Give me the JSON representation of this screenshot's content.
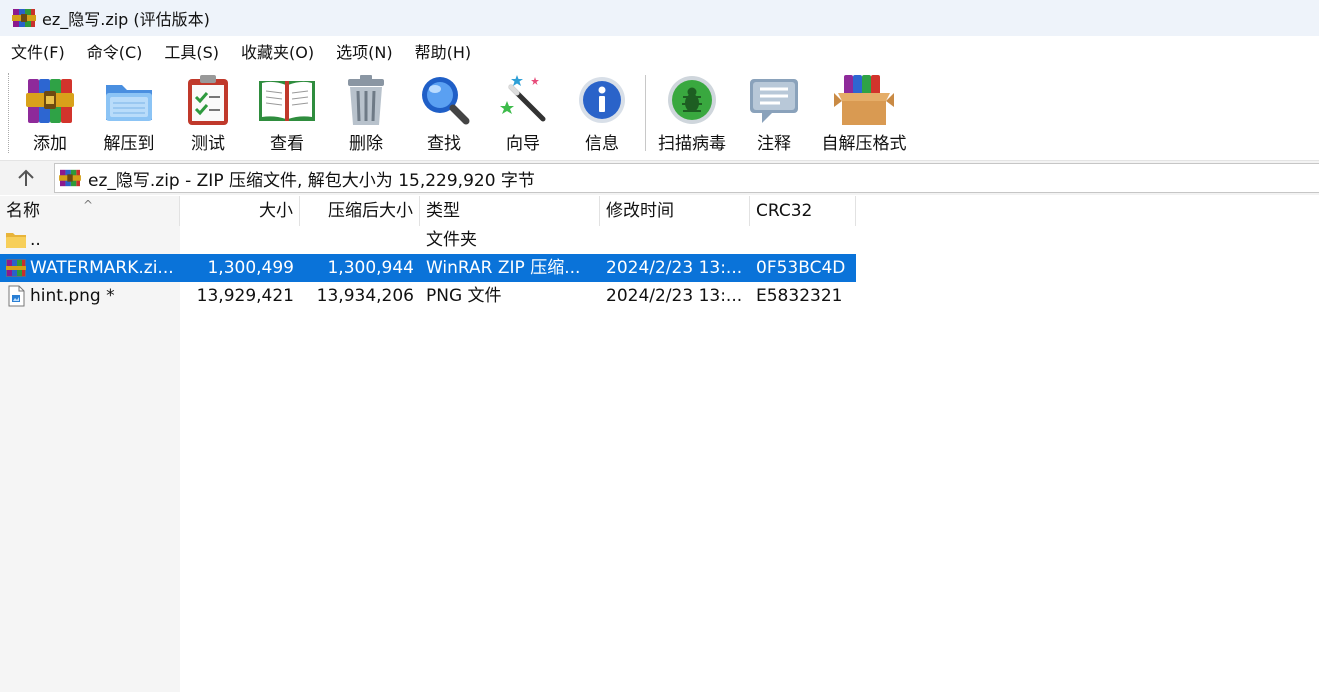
{
  "window": {
    "title": "ez_隐写.zip (评估版本)",
    "app_icon": "winrar-icon"
  },
  "menu": [
    "文件(F)",
    "命令(C)",
    "工具(S)",
    "收藏夹(O)",
    "选项(N)",
    "帮助(H)"
  ],
  "toolbar": {
    "add": "添加",
    "extract_to": "解压到",
    "test": "测试",
    "view": "查看",
    "delete": "删除",
    "find": "查找",
    "wizard": "向导",
    "info": "信息",
    "virus_scan": "扫描病毒",
    "comment": "注释",
    "sfx": "自解压格式"
  },
  "pathbar": {
    "up_icon": "up-arrow-icon",
    "text": "ez_隐写.zip - ZIP 压缩文件, 解包大小为 15,229,920 字节"
  },
  "columns": {
    "name": "名称",
    "size": "大小",
    "packed": "压缩后大小",
    "type": "类型",
    "modified": "修改时间",
    "crc": "CRC32"
  },
  "files": [
    {
      "icon": "folder-icon",
      "name": "..",
      "size": "",
      "packed": "",
      "type": "文件夹",
      "modified": "",
      "crc": ""
    },
    {
      "icon": "zip-archive-icon",
      "name": "WATERMARK.zi...",
      "size": "1,300,499",
      "packed": "1,300,944",
      "type": "WinRAR ZIP 压缩...",
      "modified": "2024/2/23 13:...",
      "crc": "0F53BC4D"
    },
    {
      "icon": "png-file-icon",
      "name": "hint.png *",
      "size": "13,929,421",
      "packed": "13,934,206",
      "type": "PNG 文件",
      "modified": "2024/2/23 13:...",
      "crc": "E5832321"
    }
  ],
  "selected_row": 1,
  "colors": {
    "selection": "#0a73d9",
    "titlebar": "#eef3fa"
  }
}
